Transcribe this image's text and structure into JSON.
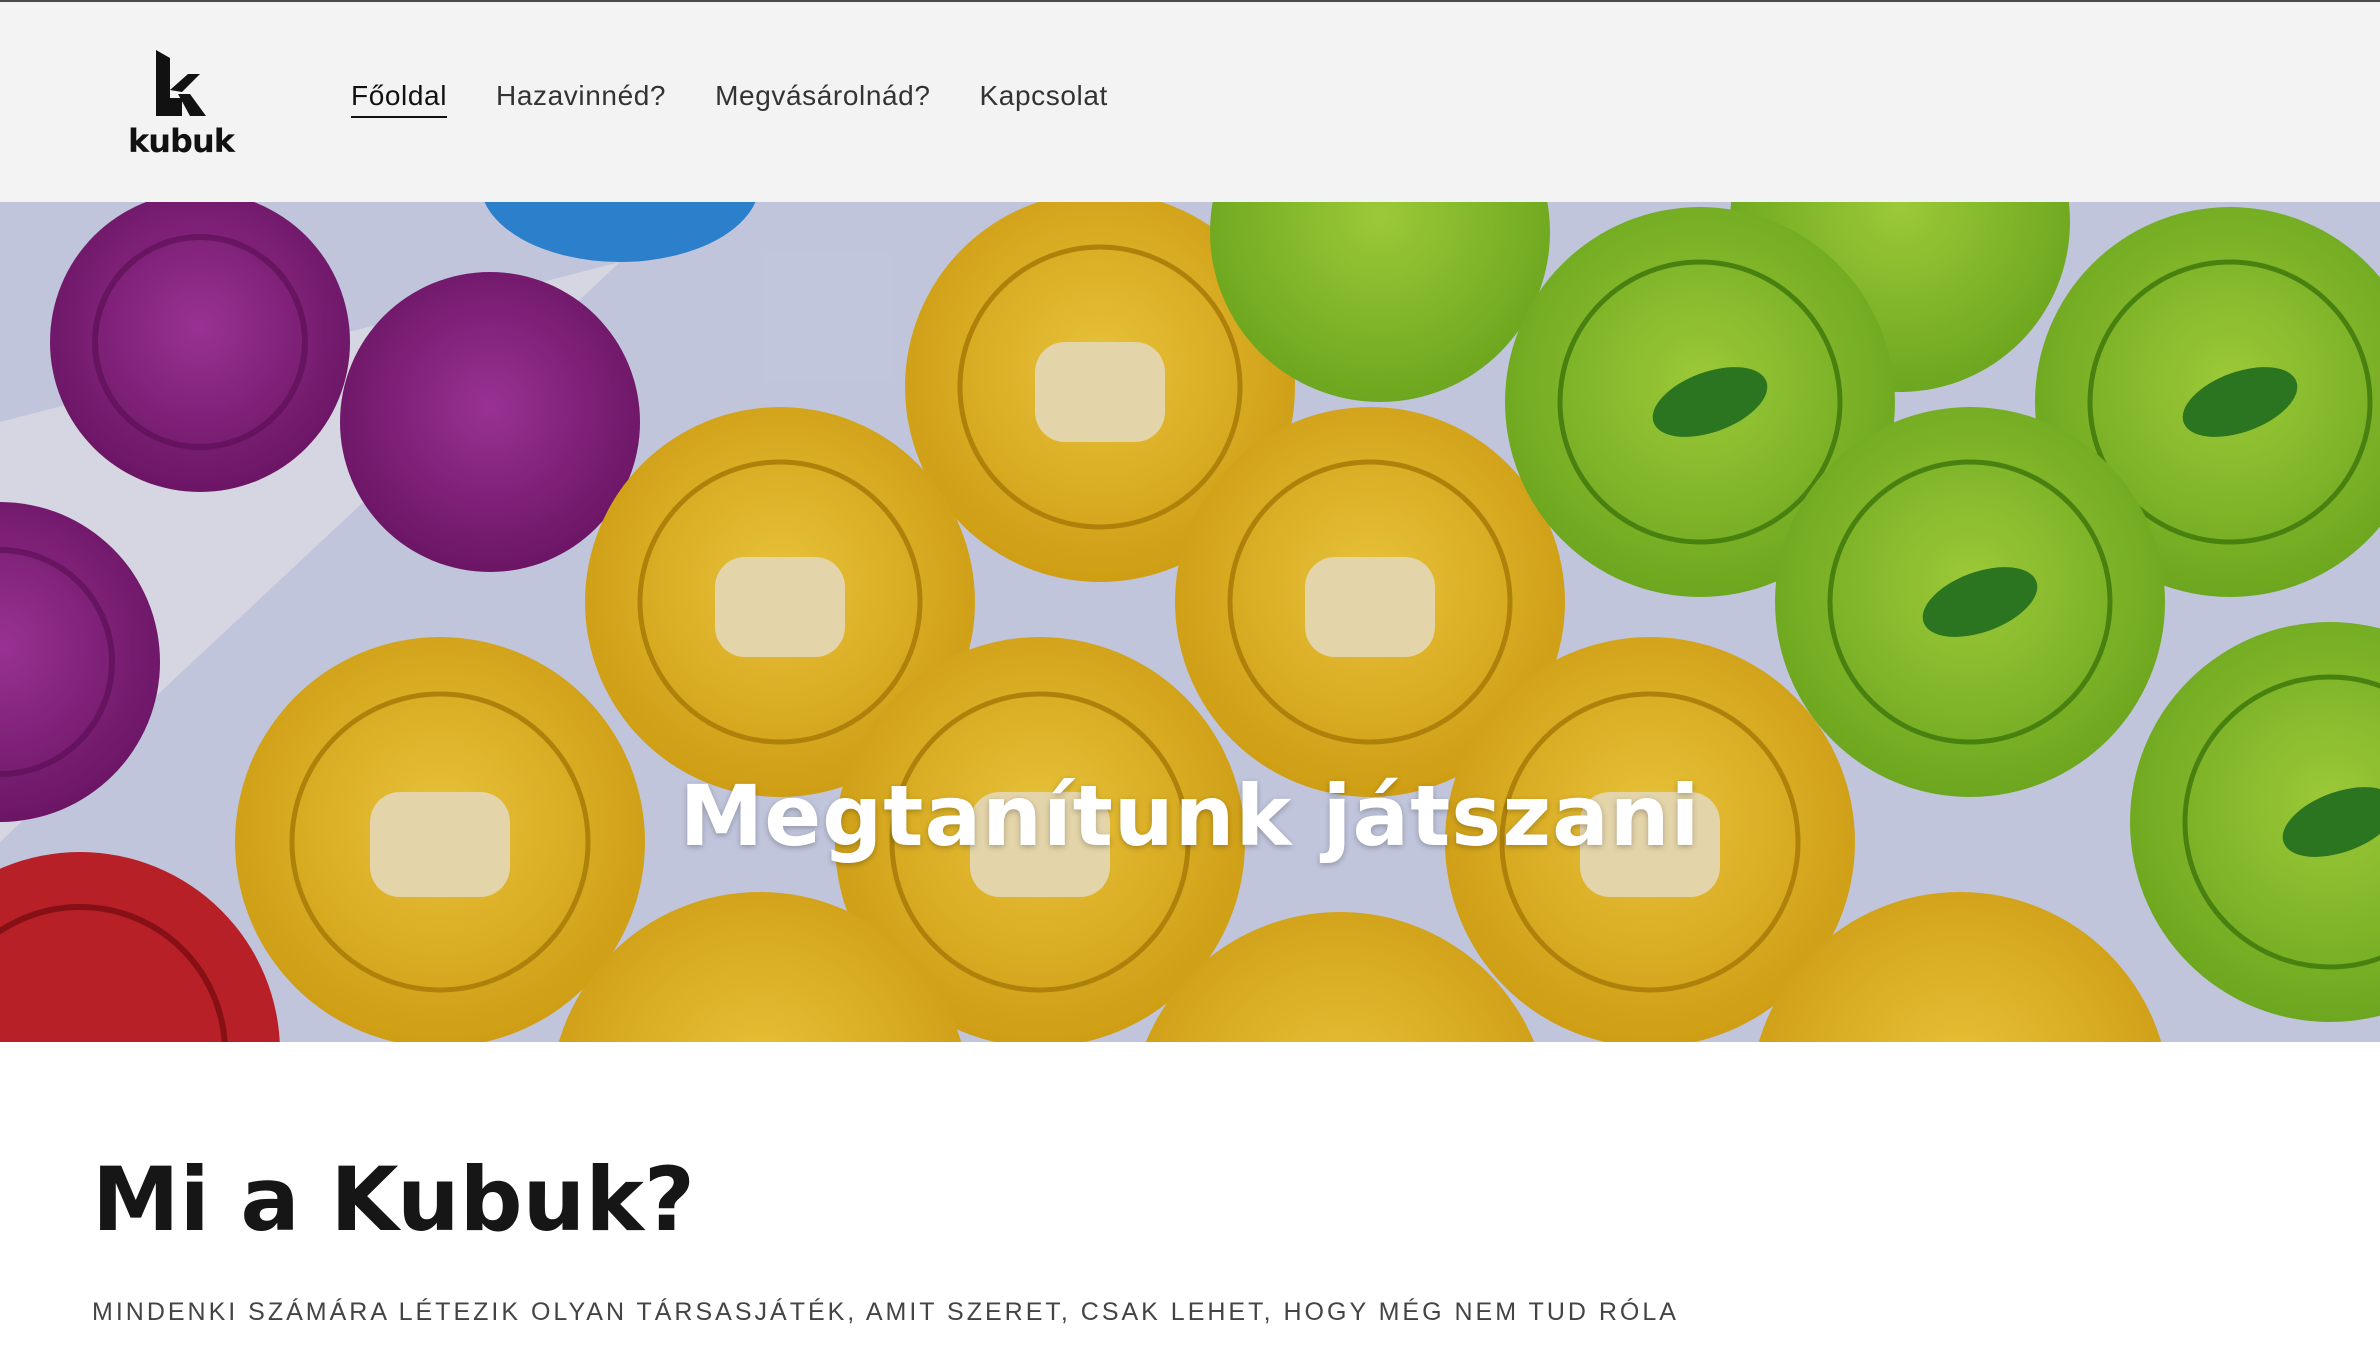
{
  "brand": {
    "logo_text": "kubuk",
    "logo_icon": "k-monogram-icon"
  },
  "nav": {
    "items": [
      {
        "label": "Főoldal",
        "active": true
      },
      {
        "label": "Hazavinnéd?",
        "active": false
      },
      {
        "label": "Megvásárolnád?",
        "active": false
      },
      {
        "label": "Kapcsolat",
        "active": false
      }
    ]
  },
  "hero": {
    "title": "Megtanítunk játszani",
    "image": "board-game-tokens-image"
  },
  "intro": {
    "heading": "Mi a Kubuk?",
    "subtitle": "MINDENKI SZÁMÁRA LÉTEZIK OLYAN TÁRSASJÁTÉK, AMIT SZERET, CSAK LEHET, HOGY MÉG NEM TUD RÓLA"
  },
  "colors": {
    "header_bg": "#f3f3f3",
    "token_yellow": "#f2c020",
    "token_green": "#8fc631",
    "token_purple": "#8a1f86",
    "token_red": "#c4222a",
    "token_blue": "#2f87d8"
  }
}
